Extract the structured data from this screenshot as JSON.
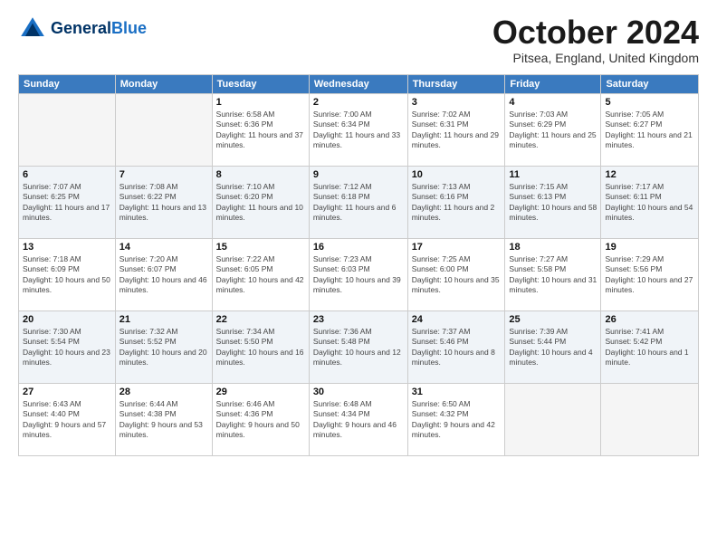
{
  "header": {
    "logo_line1": "General",
    "logo_line2": "Blue",
    "month_title": "October 2024",
    "location": "Pitsea, England, United Kingdom"
  },
  "days_of_week": [
    "Sunday",
    "Monday",
    "Tuesday",
    "Wednesday",
    "Thursday",
    "Friday",
    "Saturday"
  ],
  "weeks": [
    [
      {
        "day": "",
        "empty": true
      },
      {
        "day": "",
        "empty": true
      },
      {
        "day": "1",
        "sunrise": "Sunrise: 6:58 AM",
        "sunset": "Sunset: 6:36 PM",
        "daylight": "Daylight: 11 hours and 37 minutes."
      },
      {
        "day": "2",
        "sunrise": "Sunrise: 7:00 AM",
        "sunset": "Sunset: 6:34 PM",
        "daylight": "Daylight: 11 hours and 33 minutes."
      },
      {
        "day": "3",
        "sunrise": "Sunrise: 7:02 AM",
        "sunset": "Sunset: 6:31 PM",
        "daylight": "Daylight: 11 hours and 29 minutes."
      },
      {
        "day": "4",
        "sunrise": "Sunrise: 7:03 AM",
        "sunset": "Sunset: 6:29 PM",
        "daylight": "Daylight: 11 hours and 25 minutes."
      },
      {
        "day": "5",
        "sunrise": "Sunrise: 7:05 AM",
        "sunset": "Sunset: 6:27 PM",
        "daylight": "Daylight: 11 hours and 21 minutes."
      }
    ],
    [
      {
        "day": "6",
        "sunrise": "Sunrise: 7:07 AM",
        "sunset": "Sunset: 6:25 PM",
        "daylight": "Daylight: 11 hours and 17 minutes."
      },
      {
        "day": "7",
        "sunrise": "Sunrise: 7:08 AM",
        "sunset": "Sunset: 6:22 PM",
        "daylight": "Daylight: 11 hours and 13 minutes."
      },
      {
        "day": "8",
        "sunrise": "Sunrise: 7:10 AM",
        "sunset": "Sunset: 6:20 PM",
        "daylight": "Daylight: 11 hours and 10 minutes."
      },
      {
        "day": "9",
        "sunrise": "Sunrise: 7:12 AM",
        "sunset": "Sunset: 6:18 PM",
        "daylight": "Daylight: 11 hours and 6 minutes."
      },
      {
        "day": "10",
        "sunrise": "Sunrise: 7:13 AM",
        "sunset": "Sunset: 6:16 PM",
        "daylight": "Daylight: 11 hours and 2 minutes."
      },
      {
        "day": "11",
        "sunrise": "Sunrise: 7:15 AM",
        "sunset": "Sunset: 6:13 PM",
        "daylight": "Daylight: 10 hours and 58 minutes."
      },
      {
        "day": "12",
        "sunrise": "Sunrise: 7:17 AM",
        "sunset": "Sunset: 6:11 PM",
        "daylight": "Daylight: 10 hours and 54 minutes."
      }
    ],
    [
      {
        "day": "13",
        "sunrise": "Sunrise: 7:18 AM",
        "sunset": "Sunset: 6:09 PM",
        "daylight": "Daylight: 10 hours and 50 minutes."
      },
      {
        "day": "14",
        "sunrise": "Sunrise: 7:20 AM",
        "sunset": "Sunset: 6:07 PM",
        "daylight": "Daylight: 10 hours and 46 minutes."
      },
      {
        "day": "15",
        "sunrise": "Sunrise: 7:22 AM",
        "sunset": "Sunset: 6:05 PM",
        "daylight": "Daylight: 10 hours and 42 minutes."
      },
      {
        "day": "16",
        "sunrise": "Sunrise: 7:23 AM",
        "sunset": "Sunset: 6:03 PM",
        "daylight": "Daylight: 10 hours and 39 minutes."
      },
      {
        "day": "17",
        "sunrise": "Sunrise: 7:25 AM",
        "sunset": "Sunset: 6:00 PM",
        "daylight": "Daylight: 10 hours and 35 minutes."
      },
      {
        "day": "18",
        "sunrise": "Sunrise: 7:27 AM",
        "sunset": "Sunset: 5:58 PM",
        "daylight": "Daylight: 10 hours and 31 minutes."
      },
      {
        "day": "19",
        "sunrise": "Sunrise: 7:29 AM",
        "sunset": "Sunset: 5:56 PM",
        "daylight": "Daylight: 10 hours and 27 minutes."
      }
    ],
    [
      {
        "day": "20",
        "sunrise": "Sunrise: 7:30 AM",
        "sunset": "Sunset: 5:54 PM",
        "daylight": "Daylight: 10 hours and 23 minutes."
      },
      {
        "day": "21",
        "sunrise": "Sunrise: 7:32 AM",
        "sunset": "Sunset: 5:52 PM",
        "daylight": "Daylight: 10 hours and 20 minutes."
      },
      {
        "day": "22",
        "sunrise": "Sunrise: 7:34 AM",
        "sunset": "Sunset: 5:50 PM",
        "daylight": "Daylight: 10 hours and 16 minutes."
      },
      {
        "day": "23",
        "sunrise": "Sunrise: 7:36 AM",
        "sunset": "Sunset: 5:48 PM",
        "daylight": "Daylight: 10 hours and 12 minutes."
      },
      {
        "day": "24",
        "sunrise": "Sunrise: 7:37 AM",
        "sunset": "Sunset: 5:46 PM",
        "daylight": "Daylight: 10 hours and 8 minutes."
      },
      {
        "day": "25",
        "sunrise": "Sunrise: 7:39 AM",
        "sunset": "Sunset: 5:44 PM",
        "daylight": "Daylight: 10 hours and 4 minutes."
      },
      {
        "day": "26",
        "sunrise": "Sunrise: 7:41 AM",
        "sunset": "Sunset: 5:42 PM",
        "daylight": "Daylight: 10 hours and 1 minute."
      }
    ],
    [
      {
        "day": "27",
        "sunrise": "Sunrise: 6:43 AM",
        "sunset": "Sunset: 4:40 PM",
        "daylight": "Daylight: 9 hours and 57 minutes."
      },
      {
        "day": "28",
        "sunrise": "Sunrise: 6:44 AM",
        "sunset": "Sunset: 4:38 PM",
        "daylight": "Daylight: 9 hours and 53 minutes."
      },
      {
        "day": "29",
        "sunrise": "Sunrise: 6:46 AM",
        "sunset": "Sunset: 4:36 PM",
        "daylight": "Daylight: 9 hours and 50 minutes."
      },
      {
        "day": "30",
        "sunrise": "Sunrise: 6:48 AM",
        "sunset": "Sunset: 4:34 PM",
        "daylight": "Daylight: 9 hours and 46 minutes."
      },
      {
        "day": "31",
        "sunrise": "Sunrise: 6:50 AM",
        "sunset": "Sunset: 4:32 PM",
        "daylight": "Daylight: 9 hours and 42 minutes."
      },
      {
        "day": "",
        "empty": true
      },
      {
        "day": "",
        "empty": true
      }
    ]
  ]
}
